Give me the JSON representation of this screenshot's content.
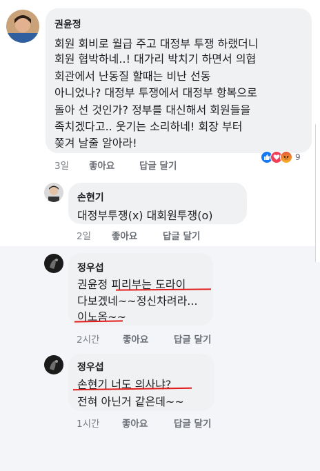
{
  "comments": [
    {
      "author": "권윤정",
      "lines": [
        "회원 회비로 월급 주고  대정부 투쟁 하랬더니",
        "회원 협박하네..!  대가리 박치기 하면서 의협",
        "회관에서  난동질 할때는  비난 선동",
        "아니었나?  대정부 투쟁에서 대정부  항복으로",
        "돌아 선 것인가? 정부를 대신해서  회원들을",
        "족치겠다고.. 웃기는 소리하네!  회장 부터",
        "쫒겨 날줄 알아라!"
      ],
      "time": "3일",
      "like": "좋아요",
      "reply": "답글 달기",
      "reactions": {
        "icons": [
          "like-icon",
          "love-icon",
          "angry-icon"
        ],
        "count": "9"
      }
    },
    {
      "author": "손현기",
      "lines": [
        "대정부투쟁(x) 대회원투쟁(o)"
      ],
      "time": "2일",
      "like": "좋아요",
      "reply": "답글 달기"
    },
    {
      "author": "정우섭",
      "lines": [
        "권윤정 피리부는 도라이",
        "다보겠네~~정신차려라...",
        "이노옴~~"
      ],
      "time": "2시간",
      "like": "좋아요",
      "reply": "답글 달기"
    },
    {
      "author": "정우섭",
      "lines": [
        "손현기 너도 의사냐?",
        "전혀 아닌거  같은데~~"
      ],
      "time": "1시간",
      "like": "좋아요",
      "reply": "답글 달기"
    }
  ],
  "colors": {
    "bubble": "#f0f1f3",
    "highlight_background": "#f3f5f9",
    "handwritten_underline": "#e11a1a",
    "like": "#1877f2",
    "love": "#f33e58",
    "angry": "#f7b125"
  }
}
